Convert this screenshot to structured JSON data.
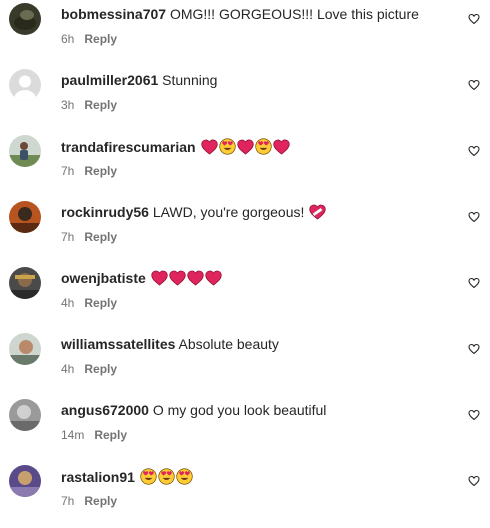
{
  "reply_label": "Reply",
  "comments": [
    {
      "username": "bobmessina707",
      "text": " OMG!!! GORGEOUS!!! Love this picture",
      "emojis": [],
      "time": "6h"
    },
    {
      "username": "paulmiller2061",
      "text": " Stunning",
      "emojis": [],
      "time": "3h"
    },
    {
      "username": "trandafirescumarian",
      "text": " ",
      "emojis": [
        "red-heart",
        "heart-eyes",
        "red-heart",
        "heart-eyes",
        "red-heart"
      ],
      "time": "7h"
    },
    {
      "username": "rockinrudy56",
      "text": " LAWD, you're gorgeous! ",
      "emojis": [
        "mending-heart"
      ],
      "time": "7h"
    },
    {
      "username": "owenjbatiste",
      "text": " ",
      "emojis": [
        "red-heart",
        "red-heart",
        "red-heart",
        "red-heart"
      ],
      "time": "4h"
    },
    {
      "username": "williamssatellites",
      "text": " Absolute beauty",
      "emojis": [],
      "time": "4h"
    },
    {
      "username": "angus672000",
      "text": " O my god you look beautiful",
      "emojis": [],
      "time": "14m"
    },
    {
      "username": "rastalion91",
      "text": " ",
      "emojis": [
        "heart-eyes",
        "heart-eyes",
        "heart-eyes"
      ],
      "time": "7h"
    }
  ],
  "colors": {
    "username": "#262626",
    "meta": "#737373",
    "heart": "#e0245e"
  }
}
